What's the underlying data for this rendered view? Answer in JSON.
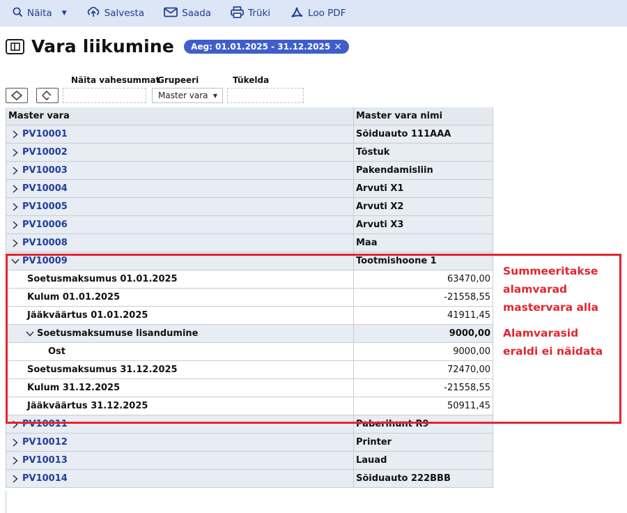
{
  "toolbar": {
    "items": [
      {
        "label": "Näita",
        "icon": "search-icon"
      },
      {
        "label": "Salvesta",
        "icon": "cloud-upload-icon"
      },
      {
        "label": "Saada",
        "icon": "envelope-icon"
      },
      {
        "label": "Trüki",
        "icon": "printer-icon"
      },
      {
        "label": "Loo PDF",
        "icon": "pdf-icon"
      }
    ]
  },
  "page": {
    "title": "Vara liikumine",
    "period_badge": "Aeg: 01.01.2025 - 31.12.2025",
    "period_close": "×"
  },
  "filters": {
    "subtotals_label": "Näita vahesummat",
    "group_label": "Grupeeri",
    "group_value": "Master vara",
    "split_label": "Tükelda"
  },
  "grid": {
    "columns": [
      "Master vara",
      "Master vara nimi"
    ],
    "rows_before": [
      {
        "code": "PV10001",
        "name": "Sõiduauto 111AAA"
      },
      {
        "code": "PV10002",
        "name": "Tõstuk"
      },
      {
        "code": "PV10003",
        "name": "Pakendamisliin"
      },
      {
        "code": "PV10004",
        "name": "Arvuti X1"
      },
      {
        "code": "PV10005",
        "name": "Arvuti X2"
      },
      {
        "code": "PV10006",
        "name": "Arvuti X3"
      },
      {
        "code": "PV10008",
        "name": "Maa"
      }
    ],
    "expanded": {
      "code": "PV10009",
      "name": "Tootmishoone 1",
      "details": [
        {
          "label": "Soetusmaksumus 01.01.2025",
          "value": "63470,00"
        },
        {
          "label": "Kulum 01.01.2025",
          "value": "-21558,55"
        },
        {
          "label": "Jääkväärtus 01.01.2025",
          "value": "41911,45"
        }
      ],
      "subgroup": {
        "label": "Soetusmaksumuse lisandumine",
        "value": "9000,00",
        "child": {
          "label": "Ost",
          "value": "9000,00"
        }
      },
      "details_after": [
        {
          "label": "Soetusmaksumus 31.12.2025",
          "value": "72470,00"
        },
        {
          "label": "Kulum 31.12.2025",
          "value": "-21558,55"
        },
        {
          "label": "Jääkväärtus 31.12.2025",
          "value": "50911,45"
        }
      ]
    },
    "rows_after": [
      {
        "code": "PV10011",
        "name": "Paberihunt R9"
      },
      {
        "code": "PV10012",
        "name": "Printer"
      },
      {
        "code": "PV10013",
        "name": "Lauad"
      },
      {
        "code": "PV10014",
        "name": "Sõiduauto 222BBB"
      }
    ]
  },
  "annotations": {
    "note1": [
      "Summeeritakse",
      "alamvarad",
      "mastervara alla"
    ],
    "note2": [
      "Alamvarasid",
      "eraldi ei näidata"
    ],
    "color": "#e2262e"
  }
}
